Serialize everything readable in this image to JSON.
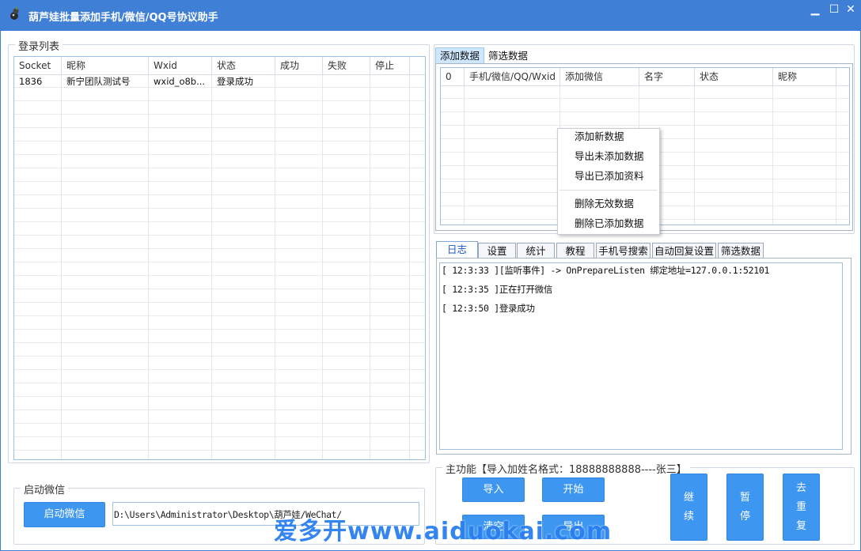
{
  "window": {
    "title": "葫芦娃批量添加手机/微信/QQ号协议助手",
    "controls": {
      "minimize": "▁",
      "maximize": "☐",
      "close": "✕"
    }
  },
  "login_list": {
    "title": "登录列表",
    "columns": [
      "Socket",
      "昵称",
      "Wxid",
      "状态",
      "成功",
      "失败",
      "停止"
    ],
    "rows": [
      [
        "1836",
        "新宁团队测试号",
        "wxid_o8b...",
        "登录成功",
        "",
        "",
        ""
      ]
    ]
  },
  "data_tabs": {
    "tabs": [
      "添加数据",
      "筛选数据"
    ],
    "columns": [
      "0",
      "手机/微信/QQ/Wxid",
      "添加微信",
      "名字",
      "状态",
      "昵称"
    ]
  },
  "context_menu": {
    "items": [
      "添加新数据",
      "导出未添加数据",
      "导出已添加资料",
      "删除无效数据",
      "删除已添加数据"
    ]
  },
  "log_tabs": {
    "tabs": [
      "日志",
      "设置",
      "统计",
      "教程",
      "手机号搜索",
      "自动回复设置",
      "筛选数据"
    ],
    "lines": [
      "[ 12:3:33 ][监听事件] -> OnPrepareListen 绑定地址=127.0.0.1:52101",
      "[ 12:3:35 ]正在打开微信",
      "[ 12:3:50 ]登录成功"
    ]
  },
  "launch": {
    "title": "启动微信",
    "button": "启动微信",
    "path": "D:\\Users\\Administrator\\Desktop\\葫芦娃/WeChat/"
  },
  "main_function": {
    "title": "主功能【导入加姓名格式：18888888888----张三】",
    "import": "导入",
    "start": "开始",
    "btn3": "清空",
    "btn4": "导出",
    "continue": [
      "继",
      "续"
    ],
    "pause": [
      "暂",
      "停"
    ],
    "dedup": [
      "去",
      "重",
      "复"
    ]
  },
  "watermark": "爱多开www.aiduokai.com",
  "colors": {
    "titlebar": "#3f7fd6",
    "button": "#3d96f0"
  }
}
